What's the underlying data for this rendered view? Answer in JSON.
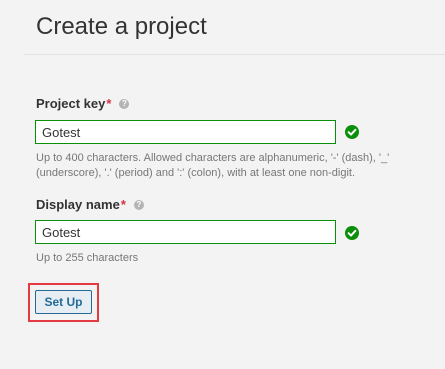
{
  "page": {
    "title": "Create a project"
  },
  "project_key": {
    "label": "Project key",
    "required_mark": "*",
    "help_icon": "question-mark-icon",
    "value": "Gotest",
    "status_icon": "check-circle-icon",
    "hint": "Up to 400 characters. Allowed characters are alphanumeric, '-' (dash), '_' (underscore), '.' (period) and ':' (colon), with at least one non-digit."
  },
  "display_name": {
    "label": "Display name",
    "required_mark": "*",
    "help_icon": "question-mark-icon",
    "value": "Gotest",
    "status_icon": "check-circle-icon",
    "hint": "Up to 255 characters"
  },
  "actions": {
    "setup_label": "Set Up"
  },
  "colors": {
    "valid": "#0a8f08",
    "primary": "#236a97",
    "highlight": "#e33b3f"
  }
}
